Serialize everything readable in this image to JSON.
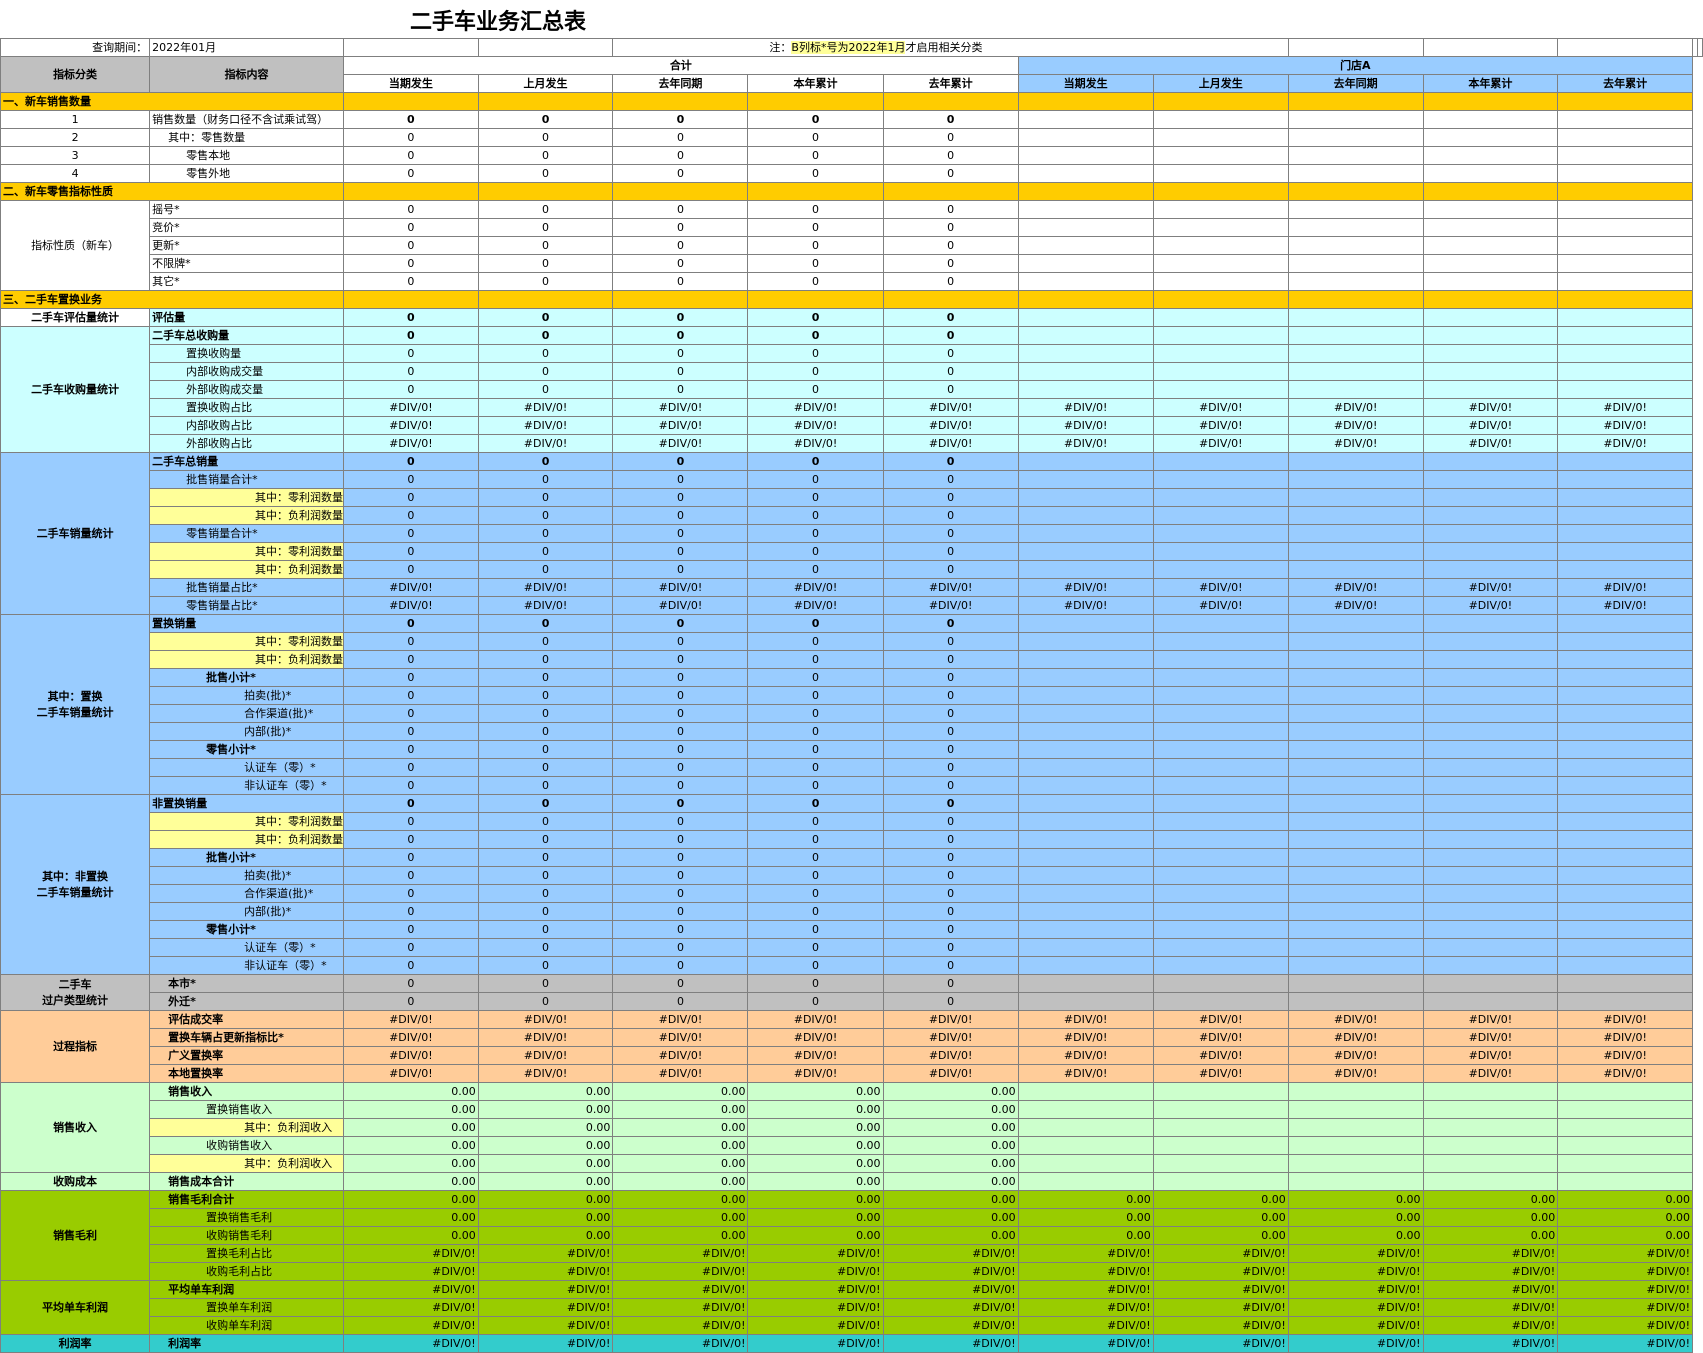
{
  "title": "二手车业务汇总表",
  "query_label": "查询期间：",
  "query_value": "2022年01月",
  "note_prefix": "注：",
  "note_highlight": "B列标*号为2022年1月",
  "note_rest": "才启用相关分类",
  "header": {
    "col_a": "指标分类",
    "col_b": "指标内容",
    "group_total": "合计",
    "group_store": "门店A",
    "sub": [
      "当期发生",
      "上月发生",
      "去年同期",
      "本年累计",
      "去年累计"
    ]
  },
  "sections": {
    "s1": "一、新车销售数量",
    "s2": "二、新车零售指标性质",
    "s3": "三、二手车置换业务"
  },
  "rows": {
    "r1": {
      "a": "1",
      "b": "销售数量（财务口径不含试乘试驾）",
      "v": "0"
    },
    "r2": {
      "a": "2",
      "b": "其中：零售数量",
      "v": "0"
    },
    "r3": {
      "a": "3",
      "b": "零售本地",
      "v": "0"
    },
    "r4": {
      "a": "4",
      "b": "零售外地",
      "v": "0"
    },
    "nature_cat": "指标性质（新车）",
    "nature": [
      "摇号*",
      "竞价*",
      "更新*",
      "不限牌*",
      "其它*"
    ],
    "eval_cat": "二手车评估量统计",
    "eval": "评估量",
    "buy_cat": "二手车收购量统计",
    "buy": [
      "二手车总收购量",
      "置换收购量",
      "内部收购成交量",
      "外部收购成交量",
      "置换收购占比",
      "内部收购占比",
      "外部收购占比"
    ],
    "sale_cat": "二手车销量统计",
    "sale": [
      "二手车总销量",
      "批售销量合计*",
      "其中：零利润数量",
      "其中：负利润数量",
      "零售销量合计*",
      "其中：零利润数量",
      "其中：负利润数量",
      "批售销量占比*",
      "零售销量占比*"
    ],
    "rep_cat": "其中：置换\n二手车销量统计",
    "rep": [
      "置换销量",
      "其中：零利润数量",
      "其中：负利润数量",
      "批售小计*",
      "拍卖(批)*",
      "合作渠道(批)*",
      "内部(批)*",
      "零售小计*",
      "认证车（零）*",
      "非认证车（零）*"
    ],
    "nrep_cat": "其中：非置换\n二手车销量统计",
    "nrep": [
      "非置换销量",
      "其中：零利润数量",
      "其中：负利润数量",
      "批售小计*",
      "拍卖(批)*",
      "合作渠道(批)*",
      "内部(批)*",
      "零售小计*",
      "认证车（零）*",
      "非认证车（零）*"
    ],
    "trans_cat": "二手车\n过户类型统计",
    "trans": [
      "本市*",
      "外迁*"
    ],
    "proc_cat": "过程指标",
    "proc": [
      "评估成交率",
      "置换车辆占更新指标比*",
      "广义置换率",
      "本地置换率"
    ],
    "inc_cat": "销售收入",
    "inc": [
      "销售收入",
      "置换销售收入",
      "其中：负利润收入",
      "收购销售收入",
      "其中：负利润收入"
    ],
    "cost_cat": "收购成本",
    "cost": "销售成本合计",
    "gp_cat": "销售毛利",
    "gp": [
      "销售毛利合计",
      "置换销售毛利",
      "收购销售毛利",
      "置换毛利占比",
      "收购毛利占比"
    ],
    "avg_cat": "平均单车利润",
    "avg": [
      "平均单车利润",
      "置换单车利润",
      "收购单车利润"
    ],
    "rate_cat": "利润率",
    "rate": "利润率"
  },
  "values": {
    "zero": "0",
    "div": "#DIV/0!",
    "money": "0.00"
  }
}
